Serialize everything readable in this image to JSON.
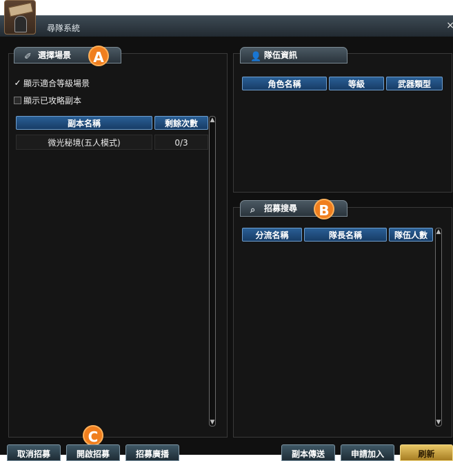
{
  "window": {
    "title": "尋隊系統",
    "close_glyph": "×"
  },
  "scene_panel": {
    "tab_label": "選擇場景",
    "filters": [
      {
        "label": "顯示適合等級場景",
        "checked": true
      },
      {
        "label": "顯示已攻略副本",
        "checked": false
      }
    ],
    "columns": [
      "副本名稱",
      "剩餘次數"
    ],
    "rows": [
      {
        "name": "微光秘境(五人模式)",
        "remaining": "0/3"
      }
    ]
  },
  "team_panel": {
    "tab_label": "隊伍資訊",
    "columns": [
      "角色名稱",
      "等級",
      "武器類型"
    ]
  },
  "recruit_panel": {
    "tab_label": "招募搜尋",
    "columns": [
      "分流名稱",
      "隊長名稱",
      "隊伍人數"
    ]
  },
  "markers": [
    "A",
    "B",
    "C"
  ],
  "buttons": {
    "cancel_recruit": "取消招募",
    "open_recruit": "開啟招募",
    "recruit_broadcast": "招募廣播",
    "dungeon_teleport": "副本傳送",
    "apply_join": "申請加入",
    "refresh": "刷新"
  },
  "colors": {
    "accent_marker": "#f07f1f",
    "header_blue": "#2a5f95",
    "window_bg": "#101010"
  }
}
